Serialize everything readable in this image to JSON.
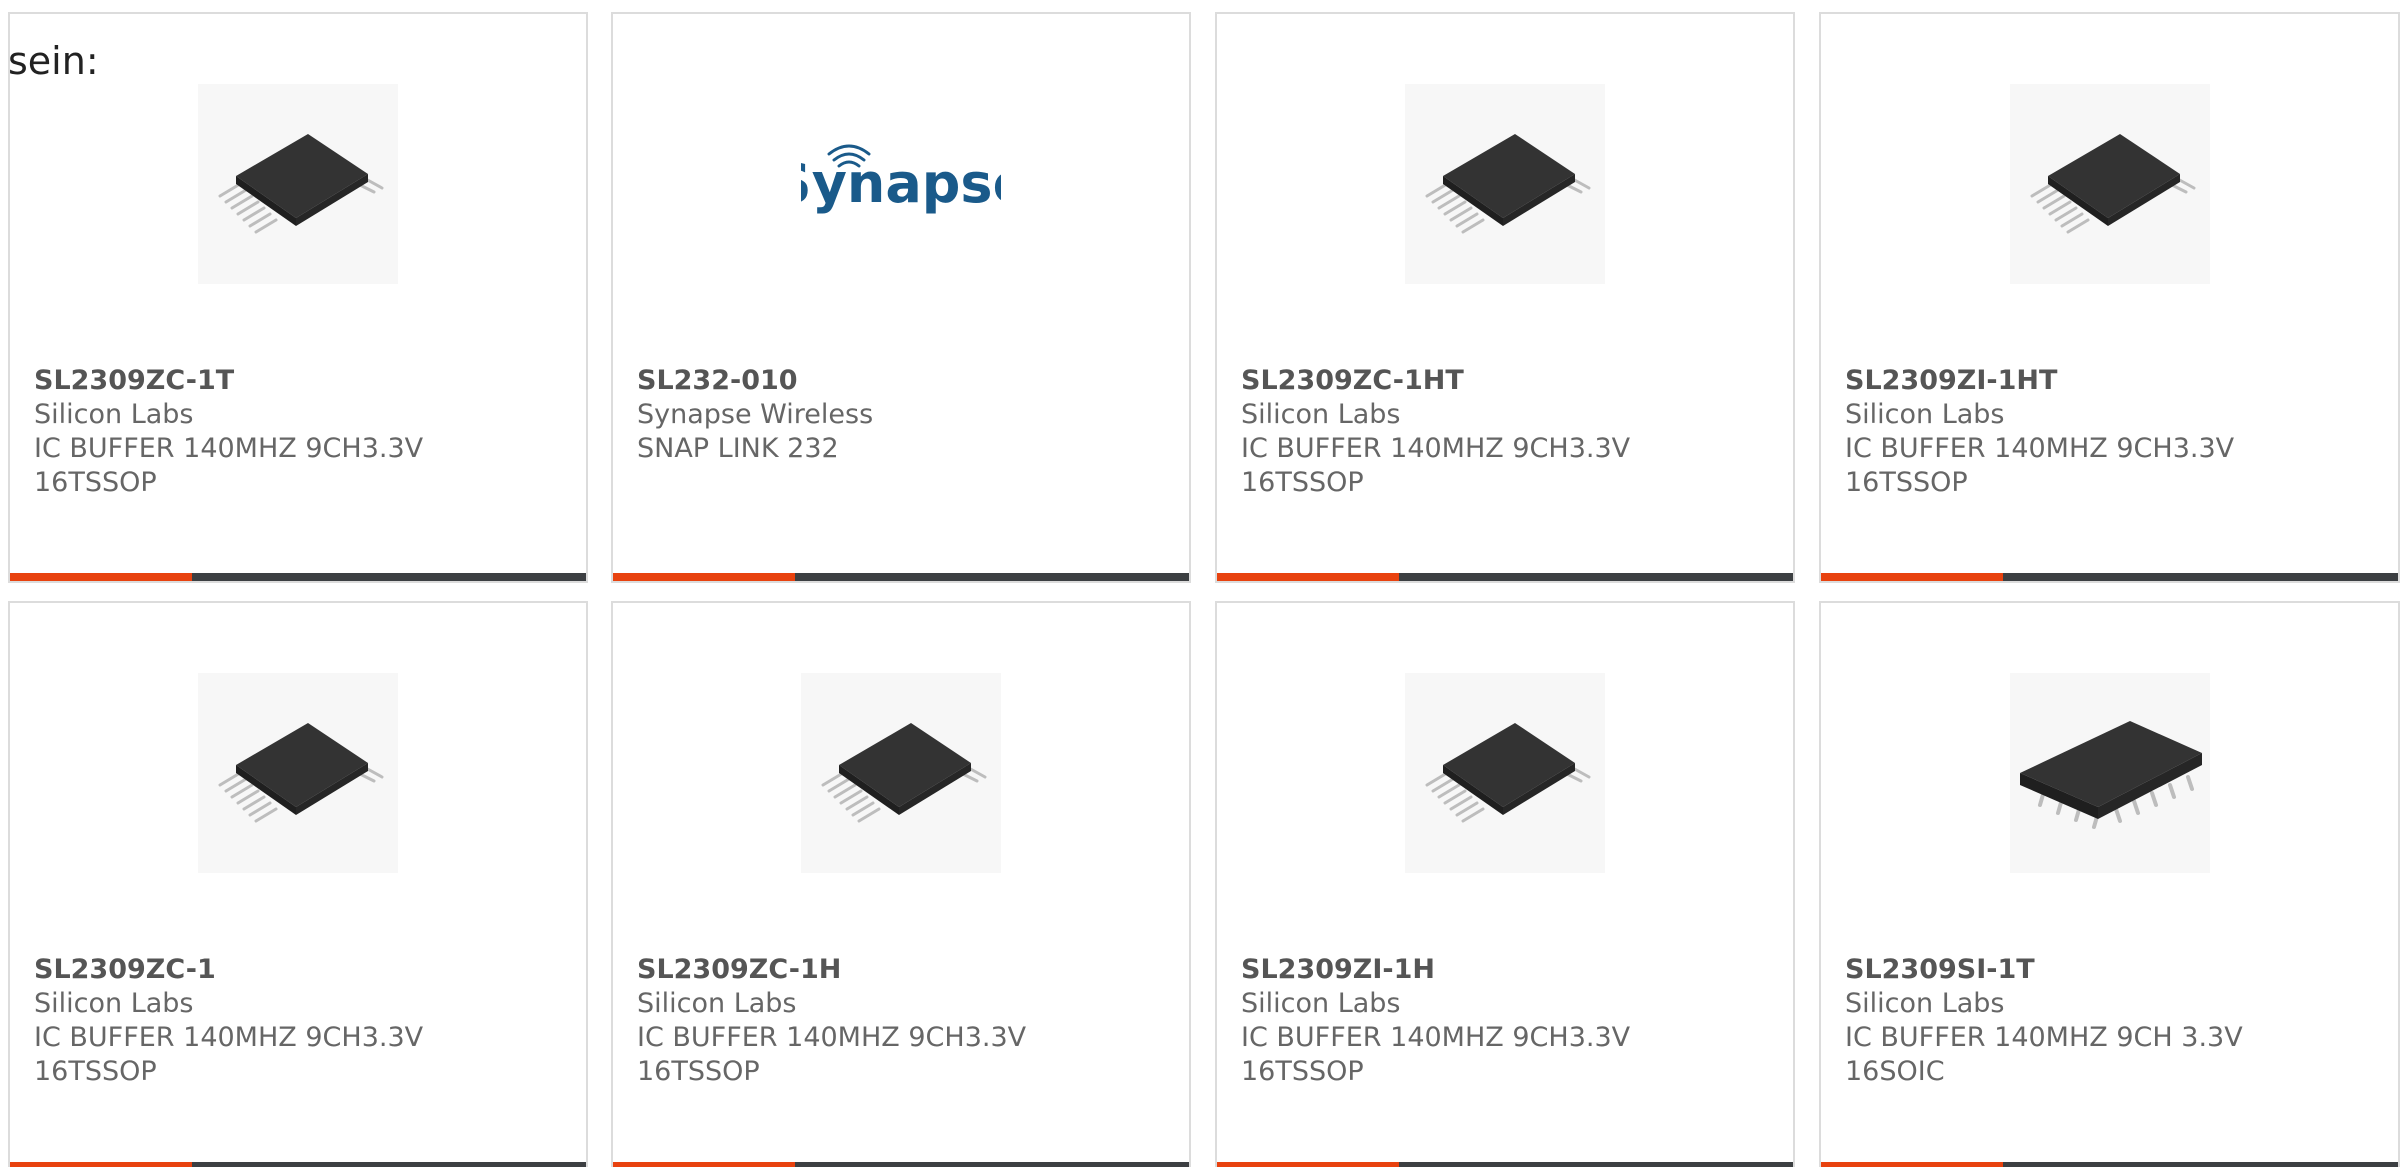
{
  "intro_text": "sein:",
  "colors": {
    "accent": "#e8420f",
    "bar": "#3c3f42",
    "brand_blue": "#1a5a8a"
  },
  "products": [
    {
      "part": "SL2309ZC-1T",
      "maker": "Silicon Labs",
      "desc1": "IC BUFFER 140MHZ 9CH3.3V",
      "desc2": "16TSSOP",
      "image": "tssop-chip-icon"
    },
    {
      "part": "SL232-010",
      "maker": "Synapse Wireless",
      "desc1": "SNAP LINK 232",
      "desc2": "",
      "image": "synapse-logo",
      "logo_text": "Synapse"
    },
    {
      "part": "SL2309ZC-1HT",
      "maker": "Silicon Labs",
      "desc1": "IC BUFFER 140MHZ 9CH3.3V",
      "desc2": "16TSSOP",
      "image": "tssop-chip-icon"
    },
    {
      "part": "SL2309ZI-1HT",
      "maker": "Silicon Labs",
      "desc1": "IC BUFFER 140MHZ 9CH3.3V",
      "desc2": "16TSSOP",
      "image": "tssop-chip-icon"
    },
    {
      "part": "SL2309ZC-1",
      "maker": "Silicon Labs",
      "desc1": "IC BUFFER 140MHZ 9CH3.3V",
      "desc2": "16TSSOP",
      "image": "tssop-chip-icon"
    },
    {
      "part": "SL2309ZC-1H",
      "maker": "Silicon Labs",
      "desc1": "IC BUFFER 140MHZ 9CH3.3V",
      "desc2": "16TSSOP",
      "image": "tssop-chip-icon"
    },
    {
      "part": "SL2309ZI-1H",
      "maker": "Silicon Labs",
      "desc1": "IC BUFFER 140MHZ 9CH3.3V",
      "desc2": "16TSSOP",
      "image": "tssop-chip-icon"
    },
    {
      "part": "SL2309SI-1T",
      "maker": "Silicon Labs",
      "desc1": "IC BUFFER 140MHZ 9CH 3.3V",
      "desc2": "16SOIC",
      "image": "soic-chip-icon"
    }
  ]
}
